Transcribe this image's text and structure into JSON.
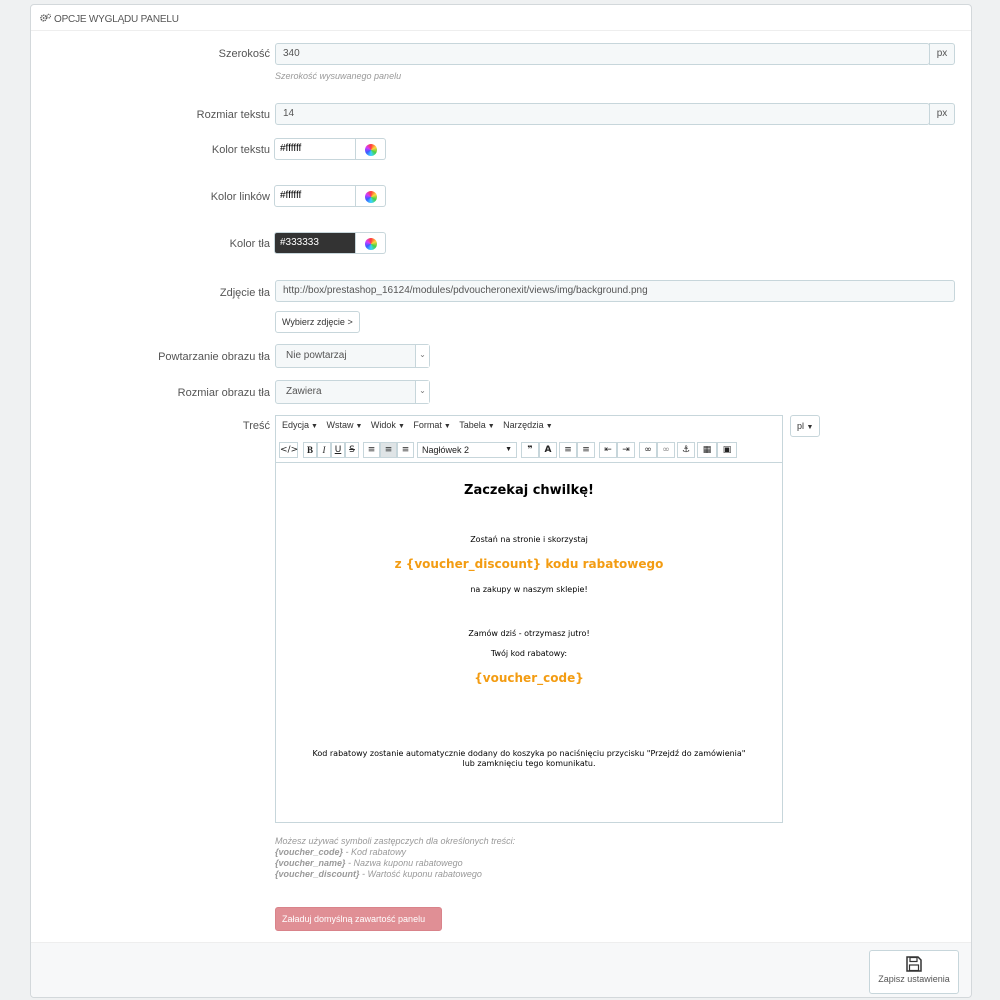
{
  "panel": {
    "title": "OPCJE WYGLĄDU PANELU",
    "icon": "gears-icon"
  },
  "width": {
    "label": "Szerokość",
    "value": "340",
    "unit": "px",
    "help": "Szerokość wysuwanego panelu"
  },
  "text_size": {
    "label": "Rozmiar tekstu",
    "value": "14",
    "unit": "px"
  },
  "text_color": {
    "label": "Kolor tekstu",
    "value": "#ffffff"
  },
  "link_color": {
    "label": "Kolor linków",
    "value": "#ffffff"
  },
  "bg_color": {
    "label": "Kolor tła",
    "value": "#333333"
  },
  "bg_image": {
    "label": "Zdjęcie tła",
    "value": "http://box/prestashop_16124/modules/pdvoucheronexit/views/img/background.png",
    "button": "Wybierz zdjęcie >"
  },
  "bg_repeat": {
    "label": "Powtarzanie obrazu tła",
    "value": "Nie powtarzaj"
  },
  "bg_size": {
    "label": "Rozmiar obrazu tła",
    "value": "Zawiera"
  },
  "content": {
    "label": "Treść",
    "menu": [
      "Edycja",
      "Wstaw",
      "Widok",
      "Format",
      "Tabela",
      "Narzędzia"
    ],
    "heading_select": "Nagłówek 2",
    "language": "pl",
    "body": {
      "title": "Zaczekaj chwilkę!",
      "line1": "Zostań na stronie i skorzystaj",
      "discount": "z {voucher_discount} kodu rabatowego",
      "line2": "na zakupy w naszym sklepie!",
      "line3": "Zamów dziś - otrzymasz jutro!",
      "line4": "Twój kod rabatowy:",
      "code": "{voucher_code}",
      "footer1": "Kod rabatowy zostanie automatycznie dodany do koszyka po naciśnięciu przycisku \"Przejdź do zamówienia\"",
      "footer2": "lub zamknięciu tego komunikatu."
    },
    "accent_color": "#f39c12"
  },
  "hints": {
    "intro": "Możesz używać symboli zastępczych dla określonych treści:",
    "items": [
      {
        "token": "{voucher_code}",
        "desc": " - Kod rabatowy"
      },
      {
        "token": "{voucher_name}",
        "desc": " - Nazwa kuponu rabatowego"
      },
      {
        "token": "{voucher_discount}",
        "desc": " - Wartość kuponu rabatowego"
      }
    ]
  },
  "load_default_button": "Załaduj domyślną zawartość panelu",
  "save_button": "Zapisz ustawienia"
}
